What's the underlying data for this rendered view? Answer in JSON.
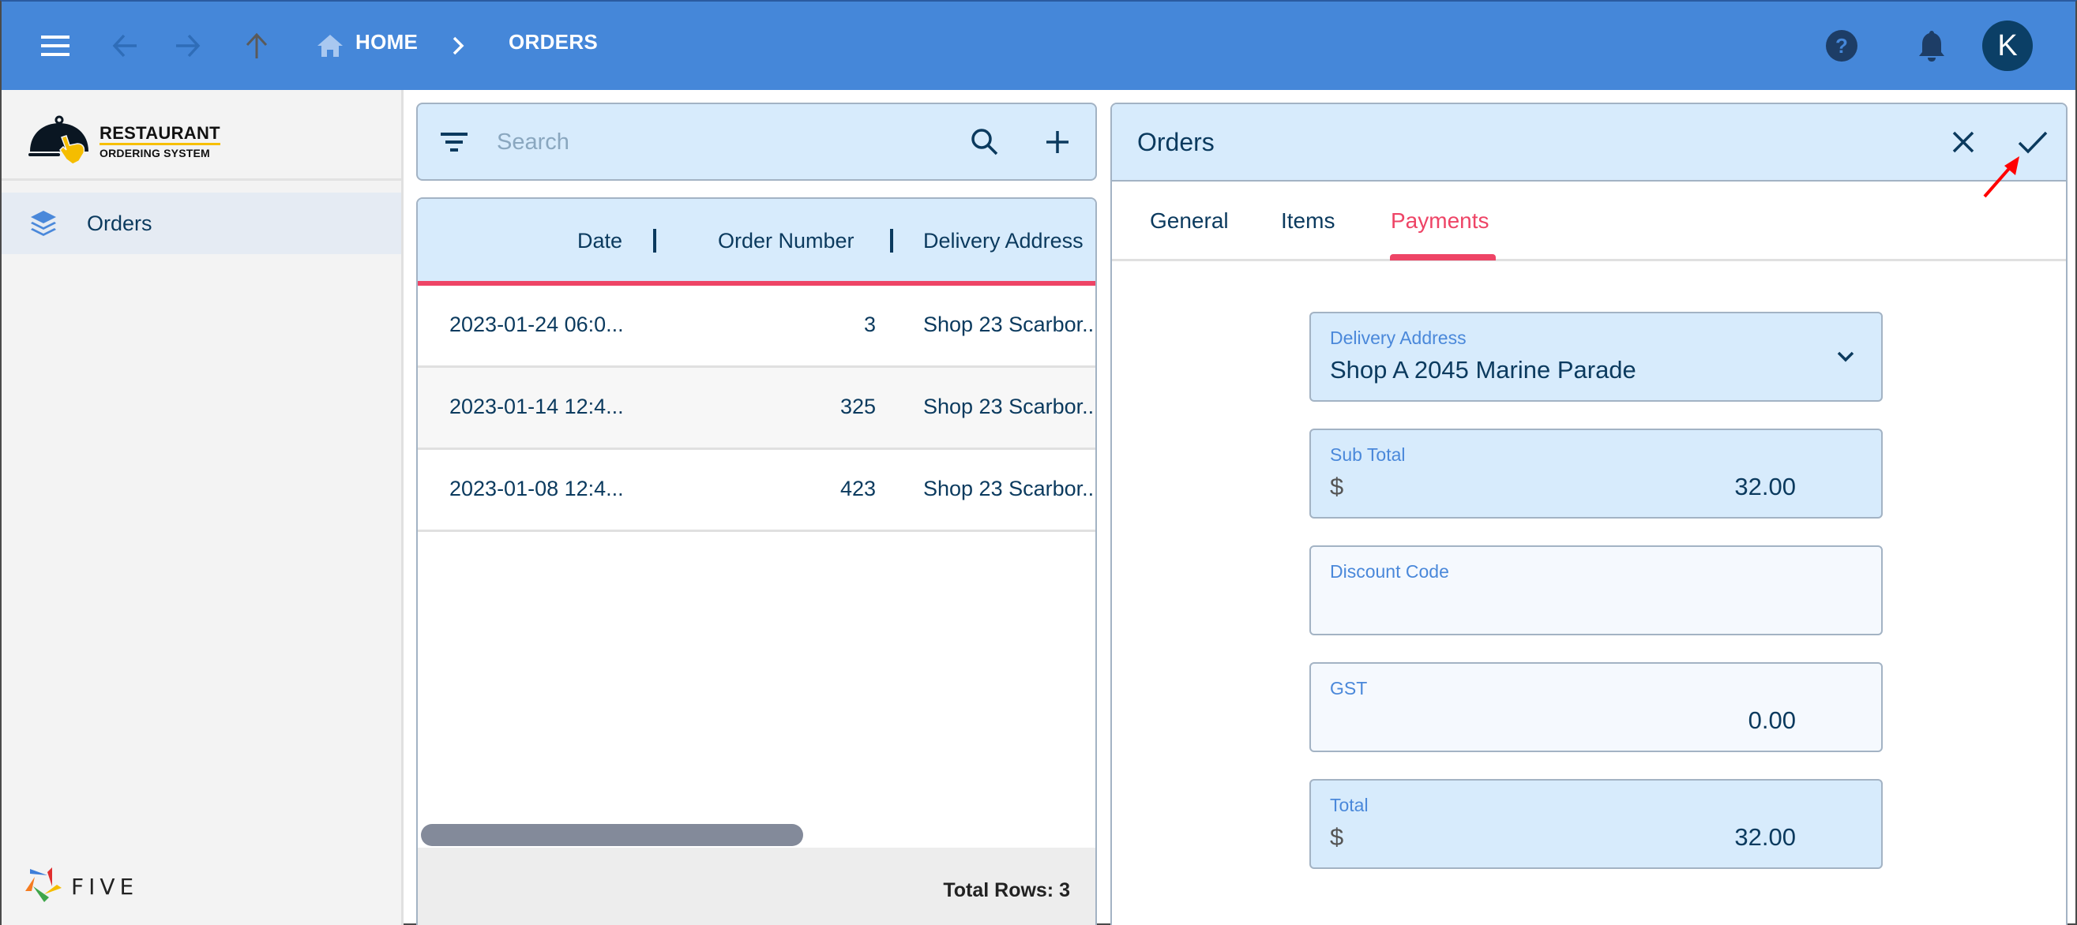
{
  "topbar": {
    "icons": {
      "menu": "menu-icon",
      "back": "arrow-back-icon",
      "forward": "arrow-forward-icon",
      "up": "arrow-up-icon",
      "home": "home-icon",
      "help": "help-icon",
      "notifications": "bell-icon"
    },
    "breadcrumb": {
      "home": "HOME",
      "separator": ">",
      "current": "ORDERS"
    },
    "avatar_initial": "K",
    "colors": {
      "bar": "#4587d9",
      "avatar": "#0b3f66"
    }
  },
  "sidebar": {
    "logo": {
      "title": "RESTAURANT",
      "subtitle": "ORDERING SYSTEM"
    },
    "items": [
      {
        "label": "Orders",
        "icon": "layers-icon",
        "active": true
      }
    ],
    "footer_brand": "FIVE"
  },
  "list": {
    "search": {
      "placeholder": "Search",
      "value": ""
    },
    "columns": [
      "Date",
      "Order Number",
      "Delivery Address"
    ],
    "rows": [
      {
        "date": "2023-01-24 06:0...",
        "order_number": "3",
        "delivery_address": "Shop 23 Scarbor..."
      },
      {
        "date": "2023-01-14 12:4...",
        "order_number": "325",
        "delivery_address": "Shop 23 Scarbor..."
      },
      {
        "date": "2023-01-08 12:4...",
        "order_number": "423",
        "delivery_address": "Shop 23 Scarbor..."
      }
    ],
    "footer": "Total Rows: 3"
  },
  "form": {
    "title": "Orders",
    "tabs": [
      {
        "label": "General",
        "active": false
      },
      {
        "label": "Items",
        "active": false
      },
      {
        "label": "Payments",
        "active": true
      }
    ],
    "fields": {
      "delivery_address": {
        "label": "Delivery Address",
        "value": "Shop A 2045 Marine Parade"
      },
      "sub_total": {
        "label": "Sub Total",
        "prefix": "$",
        "value": "32.00"
      },
      "discount_code": {
        "label": "Discount Code",
        "value": ""
      },
      "gst": {
        "label": "GST",
        "value": "0.00"
      },
      "total": {
        "label": "Total",
        "prefix": "$",
        "value": "32.00"
      }
    },
    "accent": "#ee4466"
  },
  "annotation": {
    "type": "red-arrow",
    "target": "save-check-button",
    "color": "#ff0000"
  }
}
